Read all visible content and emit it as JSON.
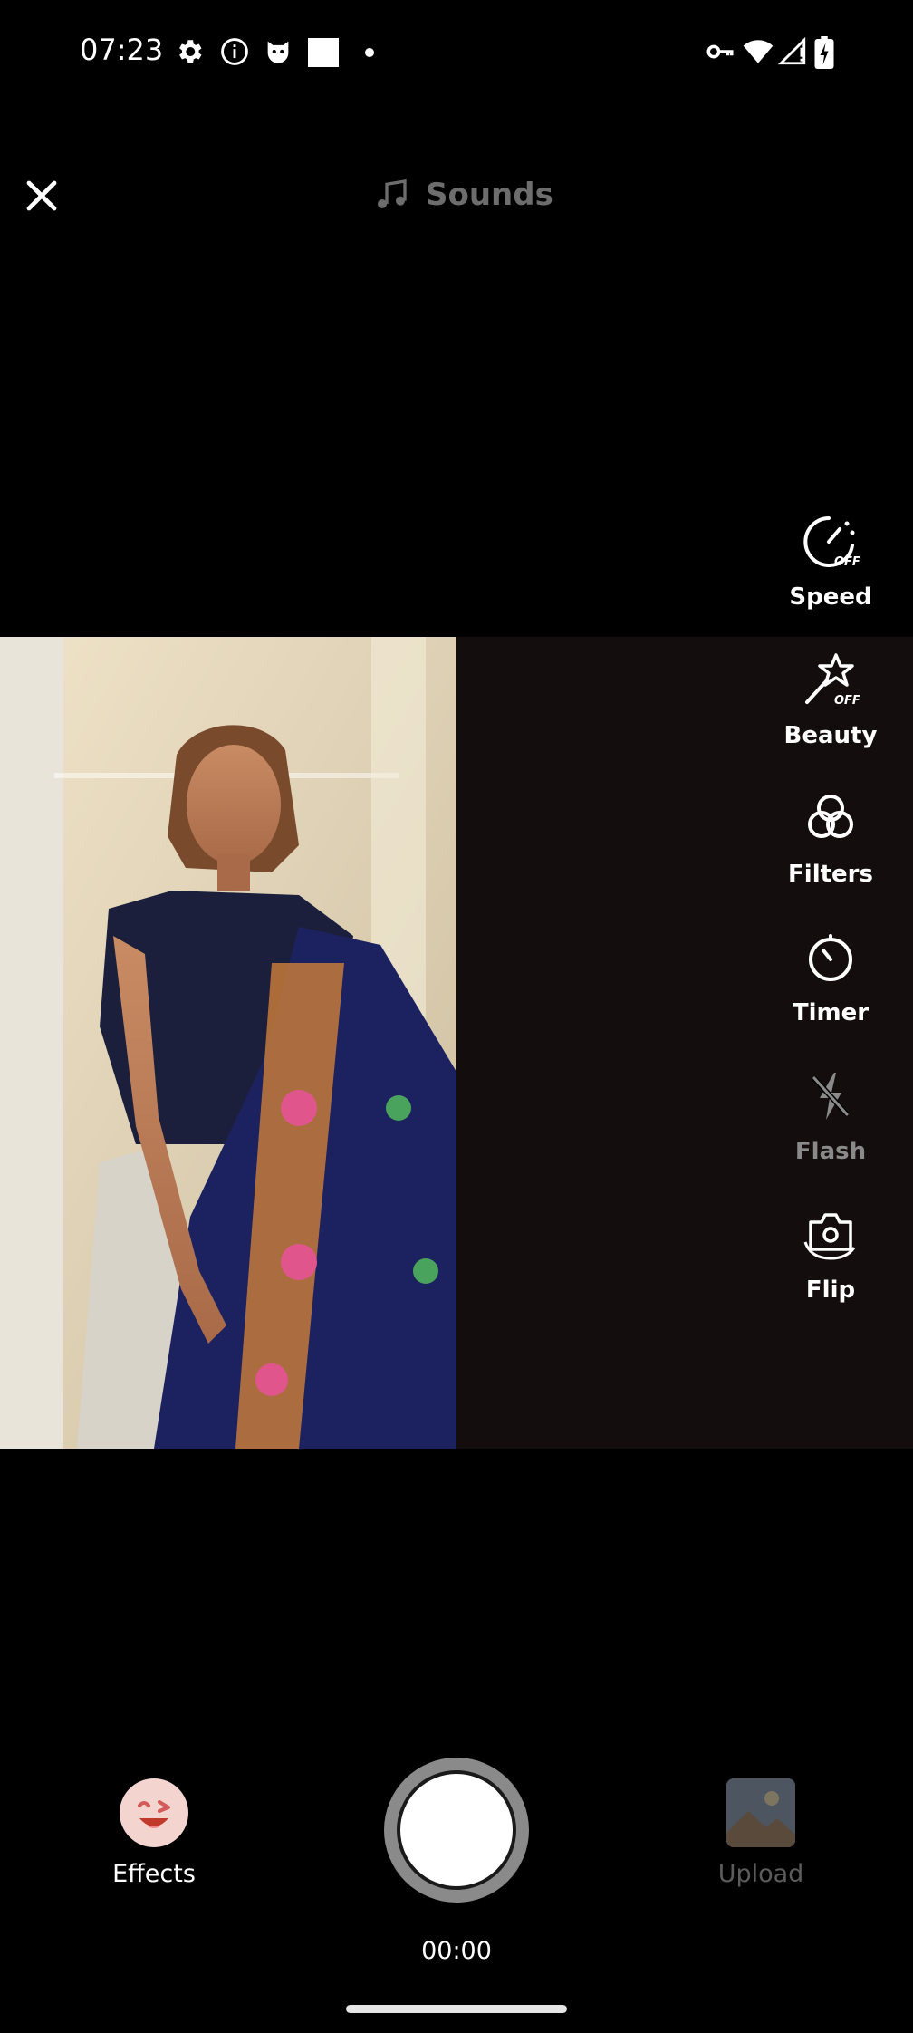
{
  "status_bar": {
    "time": "07:23",
    "left_icons": [
      "gear-icon",
      "info-icon",
      "cat-face-icon",
      "square-icon",
      "dot-icon"
    ],
    "right_icons": [
      "vpn-key-icon",
      "wifi-icon",
      "signal-icon",
      "battery-charging-icon"
    ]
  },
  "top_bar": {
    "close_icon": "close-icon",
    "sounds_label": "Sounds",
    "sounds_icon": "music-note-icon"
  },
  "tools": {
    "speed": {
      "label": "Speed",
      "icon": "speedometer-off-icon",
      "state": "OFF"
    },
    "beauty": {
      "label": "Beauty",
      "icon": "magic-wand-off-icon",
      "state": "OFF"
    },
    "filters": {
      "label": "Filters",
      "icon": "filters-icon"
    },
    "timer": {
      "label": "Timer",
      "icon": "stopwatch-icon"
    },
    "flash": {
      "label": "Flash",
      "icon": "flash-off-icon",
      "enabled": false
    },
    "flip": {
      "label": "Flip",
      "icon": "flip-camera-icon"
    }
  },
  "bottom": {
    "effects_label": "Effects",
    "upload_label": "Upload",
    "record_time": "00:00"
  },
  "colors": {
    "background": "#000000",
    "preview_bg": "#140d0e",
    "disabled_text": "#8a8a8a",
    "sounds_text": "#6d6d6d"
  }
}
